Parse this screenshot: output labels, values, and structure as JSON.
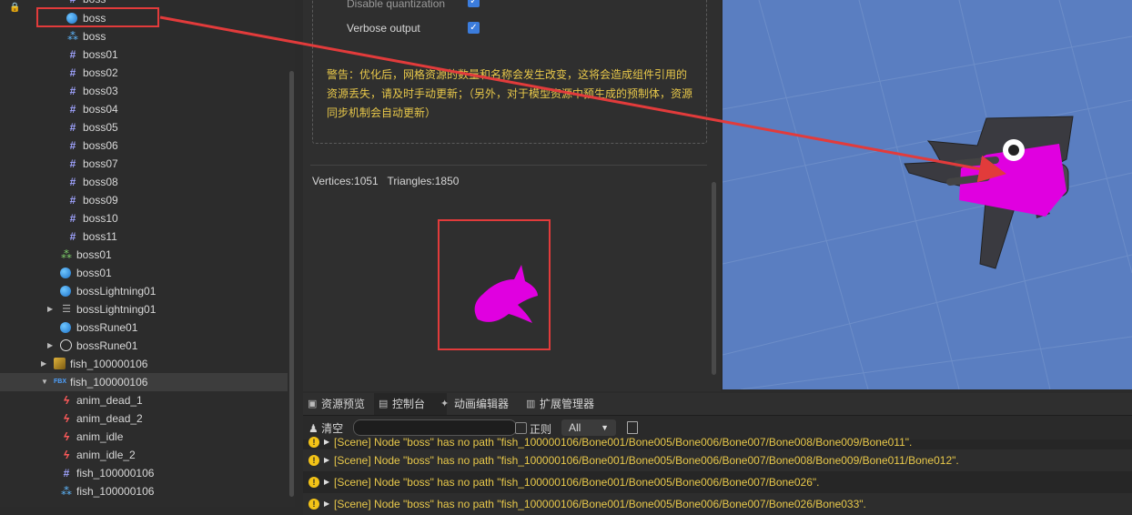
{
  "tree": {
    "items": [
      {
        "label": "boss",
        "icon": "mesh-icon"
      },
      {
        "label": "boss",
        "icon": "sphere-icon"
      },
      {
        "label": "boss",
        "icon": "prefab-icon"
      },
      {
        "label": "boss01",
        "icon": "mesh-icon"
      },
      {
        "label": "boss02",
        "icon": "mesh-icon"
      },
      {
        "label": "boss03",
        "icon": "mesh-icon"
      },
      {
        "label": "boss04",
        "icon": "mesh-icon"
      },
      {
        "label": "boss05",
        "icon": "mesh-icon"
      },
      {
        "label": "boss06",
        "icon": "mesh-icon"
      },
      {
        "label": "boss07",
        "icon": "mesh-icon"
      },
      {
        "label": "boss08",
        "icon": "mesh-icon"
      },
      {
        "label": "boss09",
        "icon": "mesh-icon"
      },
      {
        "label": "boss10",
        "icon": "mesh-icon"
      },
      {
        "label": "boss11",
        "icon": "mesh-icon"
      },
      {
        "label": "boss01",
        "icon": "multi-icon"
      },
      {
        "label": "boss01",
        "icon": "sphere-icon"
      },
      {
        "label": "bossLightning01",
        "icon": "sphere-icon"
      },
      {
        "label": "bossLightning01",
        "icon": "lines-icon"
      },
      {
        "label": "bossRune01",
        "icon": "sphere-icon"
      },
      {
        "label": "bossRune01",
        "icon": "ring-icon"
      },
      {
        "label": "fish_100000106",
        "icon": "texture-icon"
      },
      {
        "label": "fish_100000106",
        "icon": "fbx-icon"
      },
      {
        "label": "anim_dead_1",
        "icon": "anim-icon"
      },
      {
        "label": "anim_dead_2",
        "icon": "anim-icon"
      },
      {
        "label": "anim_idle",
        "icon": "anim-icon"
      },
      {
        "label": "anim_idle_2",
        "icon": "anim-icon"
      },
      {
        "label": "fish_100000106",
        "icon": "mesh-icon"
      },
      {
        "label": "fish_100000106",
        "icon": "prefab-icon"
      }
    ],
    "fbx_badge": "FBX"
  },
  "inspector": {
    "option_verbose": "Verbose output",
    "option_disable_q": "Disable quantization",
    "warning": "警告：优化后，网格资源的数量和名称会发生改变，这将会造成组件引用的资源丢失，请及时手动更新；（另外，对于模型资源中预生成的预制体，资源同步机制会自动更新）",
    "vertices": "Vertices:1051",
    "triangles": "Triangles:1850"
  },
  "console": {
    "tabs": [
      "资源预览",
      "控制台",
      "动画编辑器",
      "扩展管理器"
    ],
    "clear_label": "清空",
    "regex_label": "正则",
    "level_value": "All",
    "logs": [
      "[Scene] Node \"boss\" has no path \"fish_100000106/Bone001/Bone005/Bone006/Bone007/Bone008/Bone009/Bone011\".",
      "[Scene] Node \"boss\" has no path \"fish_100000106/Bone001/Bone005/Bone006/Bone007/Bone008/Bone009/Bone011/Bone012\".",
      "[Scene] Node \"boss\" has no path \"fish_100000106/Bone001/Bone005/Bone006/Bone007/Bone026\".",
      "[Scene] Node \"boss\" has no path \"fish_100000106/Bone001/Bone005/Bone006/Bone007/Bone026/Bone033\"."
    ]
  },
  "colors": {
    "highlight": "#e23b3b",
    "magenta": "#e000e0",
    "scene_bg": "#5a7ec1",
    "warning_text": "#e8c84a"
  }
}
